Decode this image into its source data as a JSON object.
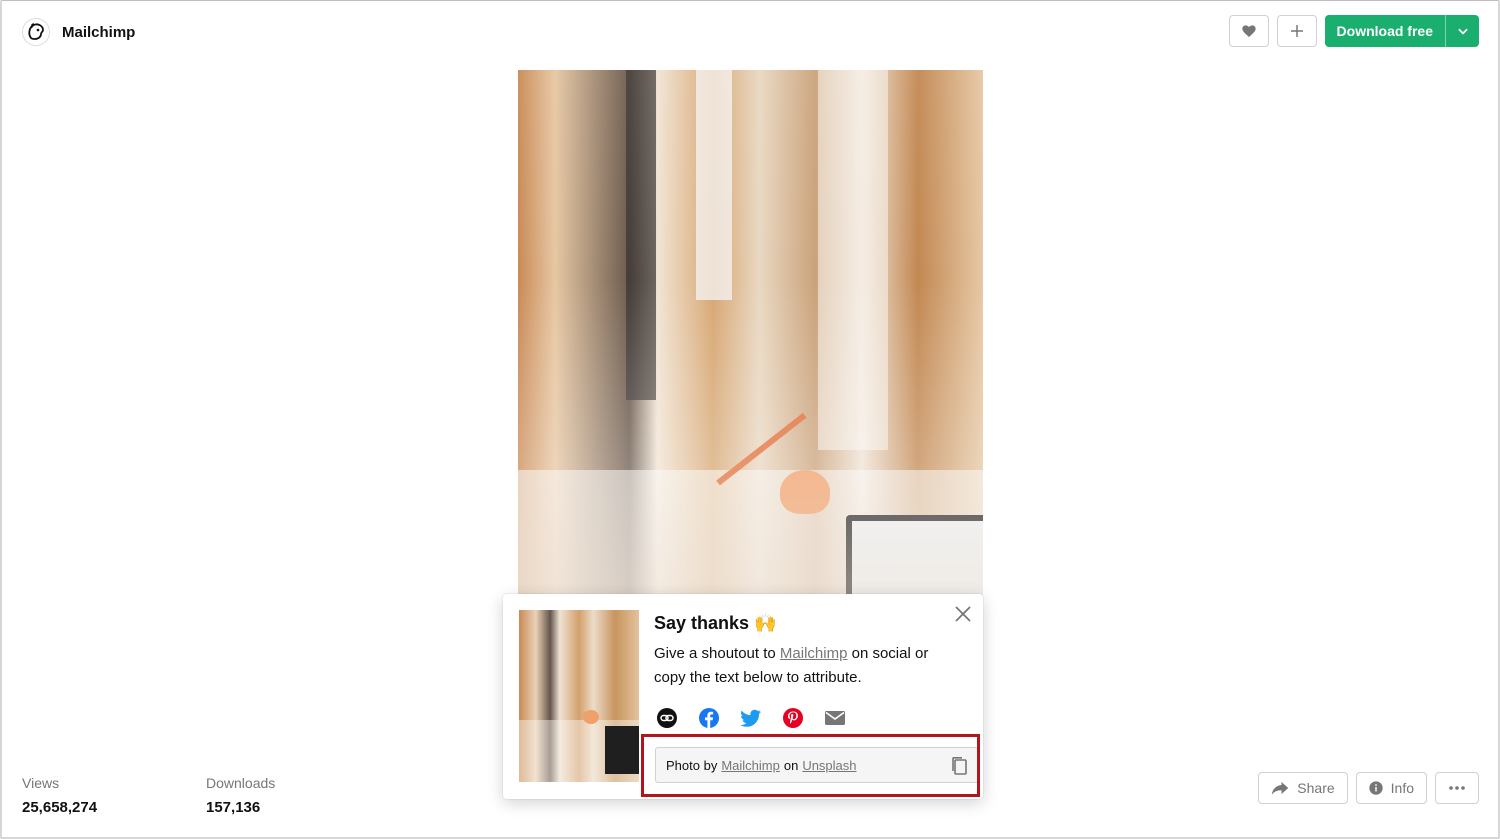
{
  "header": {
    "brand_name": "Mailchimp",
    "download_label": "Download free"
  },
  "popover": {
    "title": "Say thanks 🙌",
    "text_before": "Give a shoutout to ",
    "link_name": "Mailchimp",
    "text_after": " on social or copy the text below to attribute.",
    "attribution": {
      "prefix": "Photo by",
      "author": "Mailchimp",
      "middle": "on",
      "site": "Unsplash"
    },
    "socials": [
      "link-icon",
      "facebook-icon",
      "twitter-icon",
      "pinterest-icon",
      "email-icon"
    ]
  },
  "stats": {
    "views_label": "Views",
    "views_value": "25,658,274",
    "downloads_label": "Downloads",
    "downloads_value": "157,136"
  },
  "bottom_actions": {
    "share_label": "Share",
    "info_label": "Info"
  },
  "colors": {
    "download_green": "#1aae6f",
    "highlight_red": "#b0161b",
    "facebook_blue": "#1877f2",
    "twitter_blue": "#1d9bf0",
    "pinterest_red": "#e60023"
  }
}
